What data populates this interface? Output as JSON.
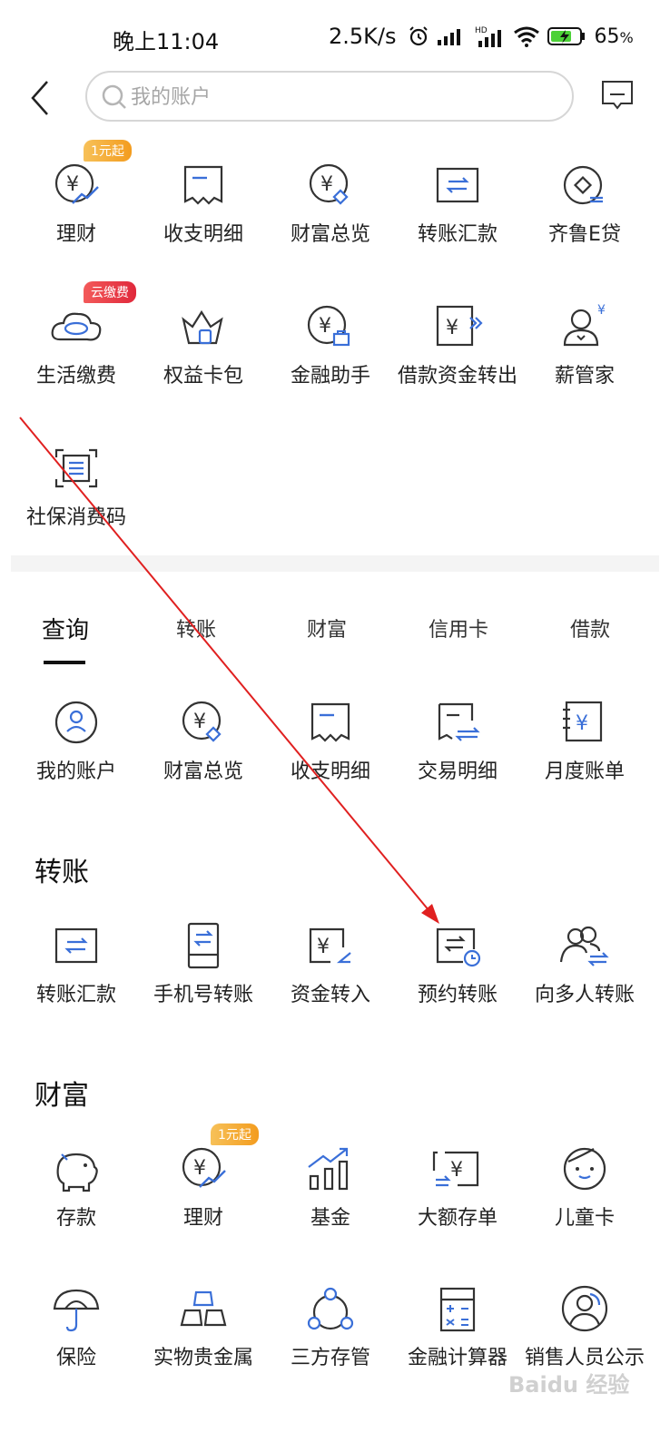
{
  "status_bar": {
    "time": "晚上11:04",
    "speed": "2.5K/s",
    "battery": "65",
    "battery_unit": "%"
  },
  "topbar": {
    "search_placeholder": "我的账户"
  },
  "quick": [
    {
      "label": "理财",
      "icon": "wealth-chart-icon",
      "badge": "1元起"
    },
    {
      "label": "收支明细",
      "icon": "receipt-icon"
    },
    {
      "label": "财富总览",
      "icon": "wealth-overview-icon"
    },
    {
      "label": "转账汇款",
      "icon": "transfer-icon"
    },
    {
      "label": "齐鲁E贷",
      "icon": "loan-coin-icon"
    },
    {
      "label": "生活缴费",
      "icon": "cloud-icon",
      "badge": "云缴费"
    },
    {
      "label": "权益卡包",
      "icon": "crown-icon"
    },
    {
      "label": "金融助手",
      "icon": "finance-assistant-icon"
    },
    {
      "label": "借款资金转出",
      "icon": "loan-transfer-out-icon"
    },
    {
      "label": "薪管家",
      "icon": "salary-manager-icon"
    },
    {
      "label": "社保消费码",
      "icon": "scan-code-icon"
    }
  ],
  "tabs": [
    "查询",
    "转账",
    "财富",
    "信用卡",
    "借款"
  ],
  "query_items": [
    {
      "label": "我的账户",
      "icon": "account-user-icon"
    },
    {
      "label": "财富总览",
      "icon": "wealth-overview-icon"
    },
    {
      "label": "收支明细",
      "icon": "receipt-icon"
    },
    {
      "label": "交易明细",
      "icon": "transaction-detail-icon"
    },
    {
      "label": "月度账单",
      "icon": "monthly-bill-icon"
    }
  ],
  "transfer_section": {
    "title": "转账",
    "items": [
      {
        "label": "转账汇款",
        "icon": "transfer-icon"
      },
      {
        "label": "手机号转账",
        "icon": "phone-transfer-icon"
      },
      {
        "label": "资金转入",
        "icon": "funds-in-icon"
      },
      {
        "label": "预约转账",
        "icon": "scheduled-transfer-icon"
      },
      {
        "label": "向多人转账",
        "icon": "multi-transfer-icon"
      }
    ]
  },
  "wealth_section": {
    "title": "财富",
    "items": [
      {
        "label": "存款",
        "icon": "piggy-bank-icon"
      },
      {
        "label": "理财",
        "icon": "wealth-chart-icon",
        "badge": "1元起"
      },
      {
        "label": "基金",
        "icon": "fund-bars-icon"
      },
      {
        "label": "大额存单",
        "icon": "large-deposit-icon"
      },
      {
        "label": "儿童卡",
        "icon": "child-face-icon"
      },
      {
        "label": "保险",
        "icon": "umbrella-icon"
      },
      {
        "label": "实物贵金属",
        "icon": "gold-bars-icon"
      },
      {
        "label": "三方存管",
        "icon": "three-party-icon"
      },
      {
        "label": "金融计算器",
        "icon": "calculator-icon"
      },
      {
        "label": "销售人员公示",
        "icon": "sales-staff-icon"
      }
    ]
  },
  "watermark": "Baidu 经验",
  "colors": {
    "accent": "#3a6fd8",
    "text": "#222222",
    "badge_orange": "#f39c1e",
    "badge_red": "#e0283b",
    "annotation_arrow": "#e02020"
  }
}
